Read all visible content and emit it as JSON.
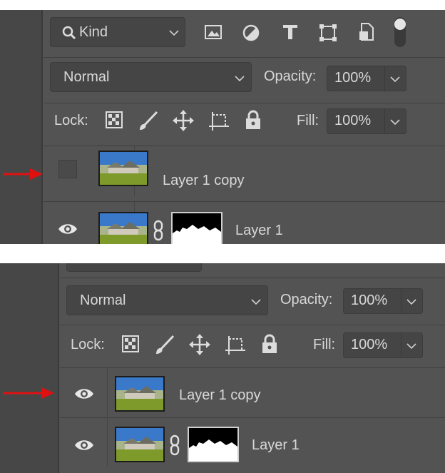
{
  "top": {
    "filter_kind": "Kind",
    "blend_mode": "Normal",
    "opacity_label": "Opacity:",
    "opacity_value": "100%",
    "lock_label": "Lock:",
    "fill_label": "Fill:",
    "fill_value": "100%",
    "layers": [
      {
        "name": "Layer 1 copy",
        "visible": false
      },
      {
        "name": "Layer 1",
        "visible": true,
        "has_mask": true
      }
    ]
  },
  "bottom": {
    "blend_mode": "Normal",
    "opacity_label": "Opacity:",
    "opacity_value": "100%",
    "lock_label": "Lock:",
    "fill_label": "Fill:",
    "fill_value": "100%",
    "layers": [
      {
        "name": "Layer 1 copy",
        "visible": true
      },
      {
        "name": "Layer 1",
        "visible": true,
        "has_mask": true
      }
    ]
  },
  "colors": {
    "panel_bg": "#535353",
    "field_bg": "#454545",
    "arrow": "#e01010"
  },
  "icons": [
    "search-icon",
    "image-filter-icon",
    "adjustment-filter-icon",
    "type-filter-icon",
    "shape-filter-icon",
    "smart-object-filter-icon",
    "filter-toggle",
    "lock-pixels-icon",
    "lock-paint-icon",
    "lock-position-icon",
    "lock-artboard-icon",
    "lock-all-icon",
    "eye-icon",
    "link-icon"
  ]
}
